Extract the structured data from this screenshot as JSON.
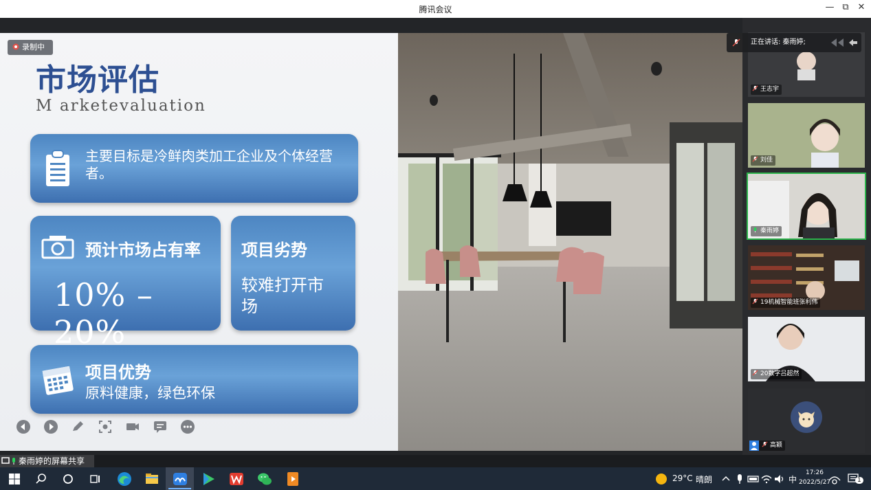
{
  "window": {
    "title": "腾讯会议",
    "minimize": "—",
    "restore": "⧉",
    "close": "✕"
  },
  "recording": {
    "label": "录制中"
  },
  "slide": {
    "title": "市场评估",
    "subtitle": "M arketevaluation",
    "card_target": {
      "text": "主要目标是冷鲜肉类加工企业及个体经营者。"
    },
    "card_share": {
      "title": "预计市场占有率",
      "value": "10% –20%"
    },
    "card_weakness": {
      "title": "项目劣势",
      "text": "较难打开市场"
    },
    "card_advantage": {
      "title": "项目优势",
      "text": "原料健康，绿色环保"
    }
  },
  "slide_controls": [
    "prev-icon",
    "next-icon",
    "pen-icon",
    "screenshot-icon",
    "camera-icon",
    "comment-icon",
    "more-icon"
  ],
  "speaking": {
    "label": "正在讲话: 秦雨婷;"
  },
  "participants": [
    {
      "name": "王志宇",
      "active": false
    },
    {
      "name": "刘佳",
      "active": false
    },
    {
      "name": "秦雨婷",
      "active": true
    },
    {
      "name": "19机械智能班张利伟",
      "active": false
    },
    {
      "name": "20数字吕超然",
      "active": false
    },
    {
      "name": "高颖",
      "active": false
    }
  ],
  "share_label": {
    "text": "秦雨婷的屏幕共享"
  },
  "taskbar": {
    "weather_temp": "29°C",
    "weather_text": "晴朗",
    "ime": "中",
    "time": "17:26",
    "date": "2022/5/27",
    "notifications": "1"
  },
  "colors": {
    "accent": "#2d4f92",
    "card": "#5a92cc",
    "active_border": "#2bb34a",
    "taskbar": "#1f2a38"
  }
}
